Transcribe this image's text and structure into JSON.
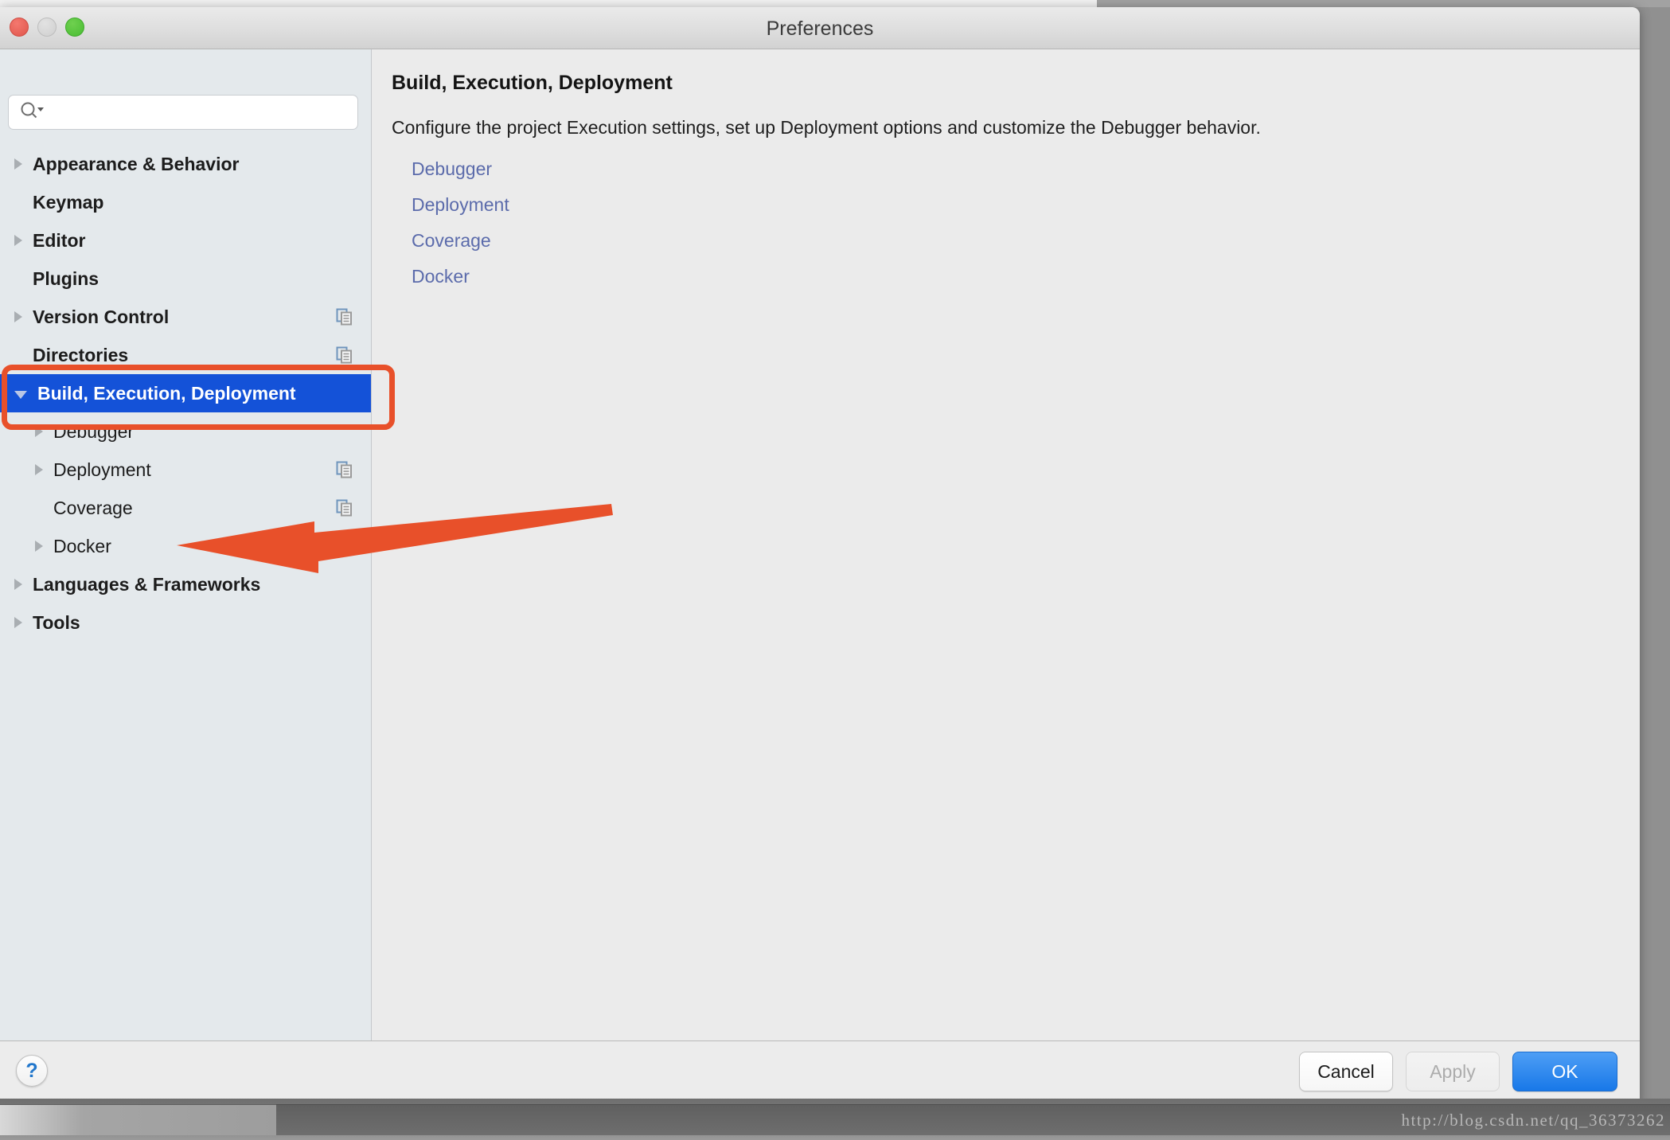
{
  "window": {
    "title": "Preferences",
    "traffic_lights": [
      "close",
      "minimize",
      "zoom"
    ]
  },
  "search": {
    "value": "",
    "placeholder": "",
    "icon": "search-icon-with-dropdown"
  },
  "sidebar": {
    "items": [
      {
        "label": "Appearance & Behavior",
        "level": 0,
        "arrow": "right",
        "bold": true,
        "selected": false,
        "copy_icon": false
      },
      {
        "label": "Keymap",
        "level": 0,
        "arrow": "none",
        "bold": true,
        "selected": false,
        "copy_icon": false
      },
      {
        "label": "Editor",
        "level": 0,
        "arrow": "right",
        "bold": true,
        "selected": false,
        "copy_icon": false
      },
      {
        "label": "Plugins",
        "level": 0,
        "arrow": "none",
        "bold": true,
        "selected": false,
        "copy_icon": false
      },
      {
        "label": "Version Control",
        "level": 0,
        "arrow": "right",
        "bold": true,
        "selected": false,
        "copy_icon": true
      },
      {
        "label": "Directories",
        "level": 0,
        "arrow": "none",
        "bold": true,
        "selected": false,
        "copy_icon": true
      },
      {
        "label": "Build, Execution, Deployment",
        "level": 0,
        "arrow": "down",
        "bold": true,
        "selected": true,
        "copy_icon": false
      },
      {
        "label": "Debugger",
        "level": 1,
        "arrow": "right",
        "bold": false,
        "selected": false,
        "copy_icon": false
      },
      {
        "label": "Deployment",
        "level": 1,
        "arrow": "right",
        "bold": false,
        "selected": false,
        "copy_icon": true
      },
      {
        "label": "Coverage",
        "level": 1,
        "arrow": "none",
        "bold": false,
        "selected": false,
        "copy_icon": true
      },
      {
        "label": "Docker",
        "level": 1,
        "arrow": "right",
        "bold": false,
        "selected": false,
        "copy_icon": false
      },
      {
        "label": "Languages & Frameworks",
        "level": 0,
        "arrow": "right",
        "bold": true,
        "selected": false,
        "copy_icon": false
      },
      {
        "label": "Tools",
        "level": 0,
        "arrow": "right",
        "bold": true,
        "selected": false,
        "copy_icon": false
      }
    ]
  },
  "main": {
    "title": "Build, Execution, Deployment",
    "description": "Configure the project Execution settings, set up Deployment options and customize the Debugger behavior.",
    "links": [
      {
        "label": "Debugger"
      },
      {
        "label": "Deployment"
      },
      {
        "label": "Coverage"
      },
      {
        "label": "Docker"
      }
    ]
  },
  "footer": {
    "help_label": "?",
    "cancel_label": "Cancel",
    "apply_label": "Apply",
    "ok_label": "OK"
  },
  "watermark": {
    "text": "http://blog.csdn.net/qq_36373262"
  },
  "annotations": {
    "highlight_color": "#e8502a",
    "selection_color": "#1452d8",
    "link_color": "#5b6bab"
  }
}
